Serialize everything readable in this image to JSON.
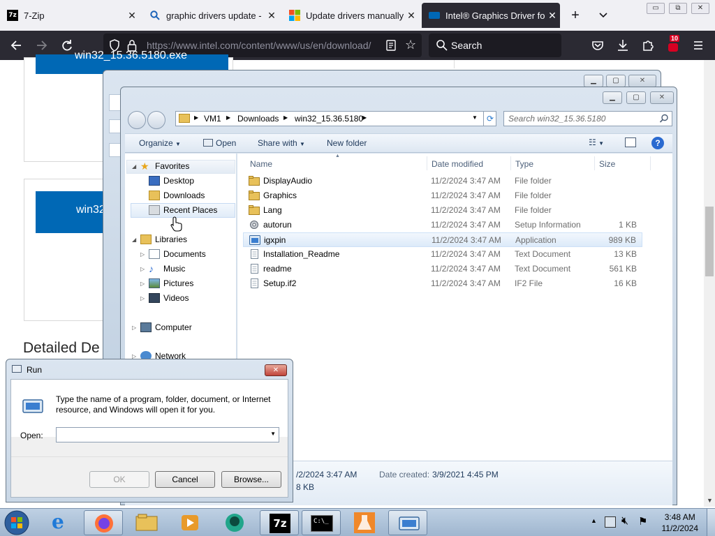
{
  "browser": {
    "tabs": [
      {
        "title": "7-Zip",
        "favicon": "7zip-logo-icon"
      },
      {
        "title": "graphic drivers update - Se",
        "favicon": "search-icon"
      },
      {
        "title": "Update drivers manually in",
        "favicon": "microsoft-logo-icon"
      },
      {
        "title": "Intel® Graphics Driver for",
        "favicon": "intel-logo-icon"
      }
    ],
    "active_tab": 3,
    "new_tab": "+",
    "url": "https://www.intel.com/content/www/us/en/download/",
    "search_placeholder": "Search",
    "extension_badge": "10",
    "title_buttons": [
      "▭",
      "⧉",
      "✕"
    ]
  },
  "webpage": {
    "top_button_text": "win32_15.36.5180.exe",
    "mid_button_text": "win32",
    "section_heading": "Detailed De"
  },
  "explorer": {
    "breadcrumb": [
      "VM1",
      "Downloads",
      "win32_15.36.5180"
    ],
    "search_placeholder": "Search win32_15.36.5180",
    "commands": {
      "organize": "Organize",
      "open": "Open",
      "share": "Share with",
      "new_folder": "New folder"
    },
    "nav": {
      "favorites": "Favorites",
      "desktop": "Desktop",
      "downloads": "Downloads",
      "recent": "Recent Places",
      "libraries": "Libraries",
      "documents": "Documents",
      "music": "Music",
      "pictures": "Pictures",
      "videos": "Videos",
      "computer": "Computer",
      "network": "Network"
    },
    "columns": {
      "name": "Name",
      "date": "Date modified",
      "type": "Type",
      "size": "Size"
    },
    "files": [
      {
        "name": "DisplayAudio",
        "date": "11/2/2024 3:47 AM",
        "type": "File folder",
        "size": "",
        "icon": "folder"
      },
      {
        "name": "Graphics",
        "date": "11/2/2024 3:47 AM",
        "type": "File folder",
        "size": "",
        "icon": "folder"
      },
      {
        "name": "Lang",
        "date": "11/2/2024 3:47 AM",
        "type": "File folder",
        "size": "",
        "icon": "folder"
      },
      {
        "name": "autorun",
        "date": "11/2/2024 3:47 AM",
        "type": "Setup Information",
        "size": "1 KB",
        "icon": "setup"
      },
      {
        "name": "igxpin",
        "date": "11/2/2024 3:47 AM",
        "type": "Application",
        "size": "989 KB",
        "icon": "app"
      },
      {
        "name": "Installation_Readme",
        "date": "11/2/2024 3:47 AM",
        "type": "Text Document",
        "size": "13 KB",
        "icon": "doc"
      },
      {
        "name": "readme",
        "date": "11/2/2024 3:47 AM",
        "type": "Text Document",
        "size": "561 KB",
        "icon": "doc"
      },
      {
        "name": "Setup.if2",
        "date": "11/2/2024 3:47 AM",
        "type": "IF2 File",
        "size": "16 KB",
        "icon": "doc"
      }
    ],
    "selected_index": 4,
    "details": {
      "modified_partial": "/2/2024 3:47 AM",
      "size_partial": "8 KB",
      "created_label": "Date created:",
      "created_value": "3/9/2021 4:45 PM"
    }
  },
  "run_dialog": {
    "title": "Run",
    "description": "Type the name of a program, folder, document, or Internet resource, and Windows will open it for you.",
    "open_label": "Open:",
    "open_value": "",
    "ok": "OK",
    "cancel": "Cancel",
    "browse": "Browse..."
  },
  "taskbar": {
    "time": "3:48 AM",
    "date": "11/2/2024"
  }
}
